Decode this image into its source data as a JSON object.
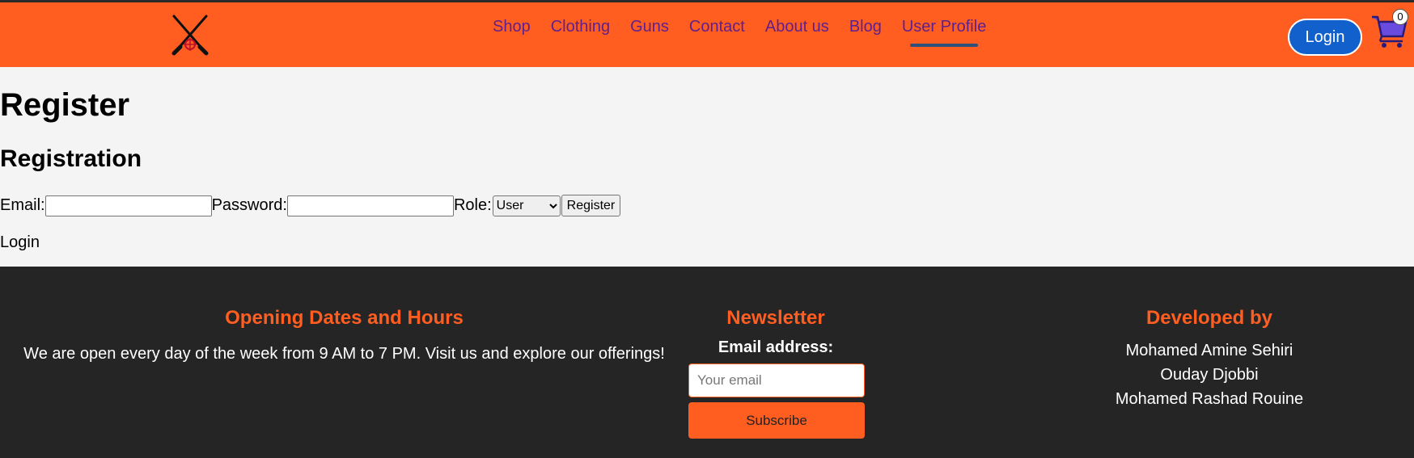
{
  "header": {
    "logo_icon": "crossed-rifles-crosshair-icon",
    "nav": [
      "Shop",
      "Clothing",
      "Guns",
      "Contact",
      "About us",
      "Blog",
      "User Profile"
    ],
    "active_nav": "User Profile",
    "login_label": "Login",
    "cart_icon": "shopping-cart-icon",
    "cart_count": "0",
    "colors": {
      "header_bg": "#ff5e20",
      "nav_text": "#5e1f8f",
      "login_bg": "#1260cc"
    }
  },
  "main": {
    "title": "Register",
    "subtitle": "Registration",
    "form": {
      "email_label": "Email:",
      "email_value": "",
      "password_label": "Password:",
      "password_value": "",
      "role_label": "Role:",
      "role_selected": "User",
      "submit_label": "Register"
    },
    "login_link": "Login"
  },
  "footer": {
    "hours_title": "Opening Dates and Hours",
    "hours_text": "We are open every day of the week from 9 AM to 7 PM. Visit us and explore our offerings!",
    "newsletter_title": "Newsletter",
    "newsletter_label": "Email address:",
    "newsletter_placeholder": "Your email",
    "subscribe_label": "Subscribe",
    "developed_title": "Developed by",
    "developers": [
      "Mohamed Amine Sehiri",
      "Ouday Djobbi",
      "Mohamed Rashad Rouine"
    ],
    "colors": {
      "footer_bg": "#252525",
      "accent": "#ff5e20"
    }
  }
}
